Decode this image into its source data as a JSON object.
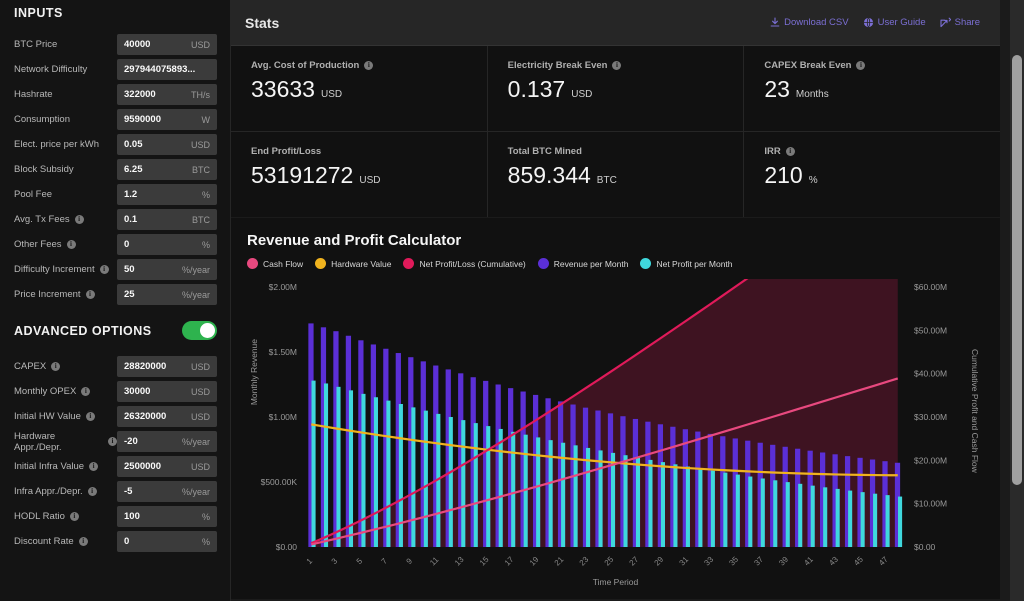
{
  "sidebar": {
    "inputs_title": "INPUTS",
    "advanced_title": "ADVANCED OPTIONS",
    "advanced_toggle_state": "on",
    "inputs": [
      {
        "label": "BTC Price",
        "info": false,
        "value": "40000",
        "unit": "USD"
      },
      {
        "label": "Network Difficulty",
        "info": false,
        "value": "297944075893...",
        "unit": ""
      },
      {
        "label": "Hashrate",
        "info": false,
        "value": "322000",
        "unit": "TH/s"
      },
      {
        "label": "Consumption",
        "info": false,
        "value": "9590000",
        "unit": "W"
      },
      {
        "label": "Elect. price per kWh",
        "info": false,
        "value": "0.05",
        "unit": "USD"
      },
      {
        "label": "Block Subsidy",
        "info": false,
        "value": "6.25",
        "unit": "BTC"
      },
      {
        "label": "Pool Fee",
        "info": false,
        "value": "1.2",
        "unit": "%"
      },
      {
        "label": "Avg. Tx Fees",
        "info": true,
        "value": "0.1",
        "unit": "BTC"
      },
      {
        "label": "Other Fees",
        "info": true,
        "value": "0",
        "unit": "%"
      },
      {
        "label": "Difficulty Increment",
        "info": true,
        "value": "50",
        "unit": "%/year"
      },
      {
        "label": "Price Increment",
        "info": true,
        "value": "25",
        "unit": "%/year"
      }
    ],
    "advanced": [
      {
        "label": "CAPEX",
        "info": true,
        "value": "28820000",
        "unit": "USD"
      },
      {
        "label": "Monthly OPEX",
        "info": true,
        "value": "30000",
        "unit": "USD"
      },
      {
        "label": "Initial HW Value",
        "info": true,
        "value": "26320000",
        "unit": "USD"
      },
      {
        "label": "Hardware Appr./Depr.",
        "info": true,
        "value": "-20",
        "unit": "%/year"
      },
      {
        "label": "Initial Infra Value",
        "info": true,
        "value": "2500000",
        "unit": "USD"
      },
      {
        "label": "Infra Appr./Depr.",
        "info": true,
        "value": "-5",
        "unit": "%/year"
      },
      {
        "label": "HODL Ratio",
        "info": true,
        "value": "100",
        "unit": "%"
      },
      {
        "label": "Discount Rate",
        "info": true,
        "value": "0",
        "unit": "%"
      }
    ]
  },
  "header": {
    "title": "Stats",
    "links": [
      {
        "label": "Download CSV",
        "icon": "download-icon"
      },
      {
        "label": "User Guide",
        "icon": "globe-icon"
      },
      {
        "label": "Share",
        "icon": "share-icon"
      }
    ],
    "link_color": "#7b6fd4"
  },
  "stats": [
    {
      "label": "Avg. Cost of Production",
      "info": true,
      "value": "33633",
      "unit": "USD"
    },
    {
      "label": "Electricity Break Even",
      "info": true,
      "value": "0.137",
      "unit": "USD"
    },
    {
      "label": "CAPEX Break Even",
      "info": true,
      "value": "23",
      "unit": "Months"
    },
    {
      "label": "End Profit/Loss",
      "info": false,
      "value": "53191272",
      "unit": "USD"
    },
    {
      "label": "Total BTC Mined",
      "info": false,
      "value": "859.344",
      "unit": "BTC"
    },
    {
      "label": "IRR",
      "info": true,
      "value": "210",
      "unit": "%"
    }
  ],
  "chart_data": {
    "type": "bar",
    "title": "Revenue and Profit Calculator",
    "xlabel": "Time Period",
    "ylabel": "Monthly Revenue",
    "y2label": "Cumulative Profit and Cash Flow",
    "grid": false,
    "legend_position": "top",
    "ylim": [
      0,
      2000000
    ],
    "y2lim": [
      0,
      60000000
    ],
    "ytick_labels": [
      "$0.00",
      "$500.00K",
      "$1.00M",
      "$1.50M",
      "$2.00M"
    ],
    "ytick_values": [
      0,
      500000,
      1000000,
      1500000,
      2000000
    ],
    "y2tick_labels": [
      "$0.00",
      "$10.00M",
      "$20.00M",
      "$30.00M",
      "$40.00M",
      "$50.00M",
      "$60.00M"
    ],
    "y2tick_values": [
      0,
      10000000,
      20000000,
      30000000,
      40000000,
      50000000,
      60000000
    ],
    "x": [
      1,
      2,
      3,
      4,
      5,
      6,
      7,
      8,
      9,
      10,
      11,
      12,
      13,
      14,
      15,
      16,
      17,
      18,
      19,
      20,
      21,
      22,
      23,
      24,
      25,
      26,
      27,
      28,
      29,
      30,
      31,
      32,
      33,
      34,
      35,
      36,
      37,
      38,
      39,
      40,
      41,
      42,
      43,
      44,
      45,
      46,
      47,
      48
    ],
    "xtick_labels": [
      "1",
      "3",
      "5",
      "7",
      "9",
      "11",
      "13",
      "15",
      "17",
      "19",
      "21",
      "23",
      "25",
      "27",
      "29",
      "31",
      "33",
      "35",
      "37",
      "39",
      "41",
      "43",
      "45",
      "47"
    ],
    "legend": [
      {
        "name": "Cash Flow",
        "color": "#e8497f"
      },
      {
        "name": "Hardware Value",
        "color": "#f0b31e"
      },
      {
        "name": "Net Profit/Loss (Cumulative)",
        "color": "#e01a5a"
      },
      {
        "name": "Revenue per Month",
        "color": "#5b2fd6"
      },
      {
        "name": "Net Profit per Month",
        "color": "#3fd8dd"
      }
    ],
    "series": [
      {
        "name": "Revenue per Month",
        "type": "bar",
        "axis": "left",
        "color": "#5b2fd6",
        "values": [
          1720000,
          1690000,
          1660000,
          1625000,
          1590000,
          1558000,
          1525000,
          1492000,
          1460000,
          1428000,
          1396000,
          1366000,
          1336000,
          1306000,
          1278000,
          1250000,
          1222000,
          1196000,
          1170000,
          1144000,
          1120000,
          1096000,
          1072000,
          1050000,
          1028000,
          1006000,
          985000,
          964000,
          944000,
          925000,
          906000,
          888000,
          870000,
          852000,
          835000,
          818000,
          802000,
          786000,
          771000,
          756000,
          741000,
          727000,
          713000,
          699000,
          686000,
          673000,
          660000,
          648000
        ]
      },
      {
        "name": "Net Profit per Month",
        "type": "bar",
        "axis": "left",
        "color": "#3fd8dd",
        "values": [
          1280000,
          1258000,
          1232000,
          1205000,
          1178000,
          1152000,
          1126000,
          1100000,
          1074000,
          1049000,
          1024000,
          1000000,
          976000,
          953000,
          930000,
          908000,
          886000,
          864000,
          843000,
          822000,
          802000,
          782000,
          762000,
          743000,
          724000,
          706000,
          688000,
          670000,
          653000,
          636000,
          619000,
          603000,
          587000,
          572000,
          557000,
          542000,
          527000,
          513000,
          499000,
          486000,
          472000,
          459000,
          447000,
          434000,
          422000,
          410000,
          399000,
          388000
        ]
      },
      {
        "name": "Net Profit/Loss (Cumulative)",
        "type": "line-area",
        "axis": "right",
        "color": "#e01a5a",
        "values": [
          880000,
          2100000,
          3400000,
          4750000,
          6150000,
          7600000,
          9080000,
          10600000,
          12160000,
          13750000,
          15370000,
          17020000,
          18700000,
          20400000,
          22130000,
          23880000,
          25650000,
          27440000,
          29250000,
          31080000,
          32930000,
          34790000,
          36670000,
          38560000,
          40460000,
          42380000,
          44310000,
          46250000,
          48200000,
          50160000,
          52130000,
          54100000,
          56080000,
          58080000,
          60080000,
          62090000,
          64100000,
          66120000,
          68150000,
          70180000,
          72210000,
          74250000,
          76290000,
          78340000,
          80380000,
          82430000,
          84480000,
          86530000
        ]
      },
      {
        "name": "Cash Flow",
        "type": "line",
        "axis": "right",
        "color": "#e8497f",
        "values": [
          600000,
          1250000,
          1920000,
          2600000,
          3290000,
          3990000,
          4700000,
          5420000,
          6150000,
          6890000,
          7640000,
          8400000,
          9160000,
          9930000,
          10710000,
          11500000,
          12290000,
          13090000,
          13900000,
          14710000,
          15530000,
          16350000,
          17180000,
          18010000,
          18850000,
          19690000,
          20540000,
          21390000,
          22240000,
          23100000,
          23960000,
          24820000,
          25690000,
          26560000,
          27430000,
          28300000,
          29180000,
          30060000,
          30940000,
          31820000,
          32700000,
          33580000,
          34470000,
          35350000,
          36240000,
          37120000,
          38010000,
          38900000
        ]
      },
      {
        "name": "Hardware Value",
        "type": "line",
        "axis": "right",
        "color": "#f0b31e",
        "values": [
          28300000,
          27820000,
          27350000,
          26890000,
          26440000,
          26000000,
          25570000,
          25150000,
          24740000,
          24340000,
          23950000,
          23570000,
          23200000,
          22840000,
          22490000,
          22150000,
          21820000,
          21500000,
          21190000,
          20890000,
          20600000,
          20320000,
          20050000,
          19790000,
          19540000,
          19300000,
          19070000,
          18850000,
          18640000,
          18440000,
          18250000,
          18070000,
          17900000,
          17740000,
          17590000,
          17450000,
          17320000,
          17200000,
          17090000,
          16990000,
          16900000,
          16820000,
          16750000,
          16690000,
          16640000,
          16600000,
          16570000,
          16550000
        ]
      }
    ]
  }
}
